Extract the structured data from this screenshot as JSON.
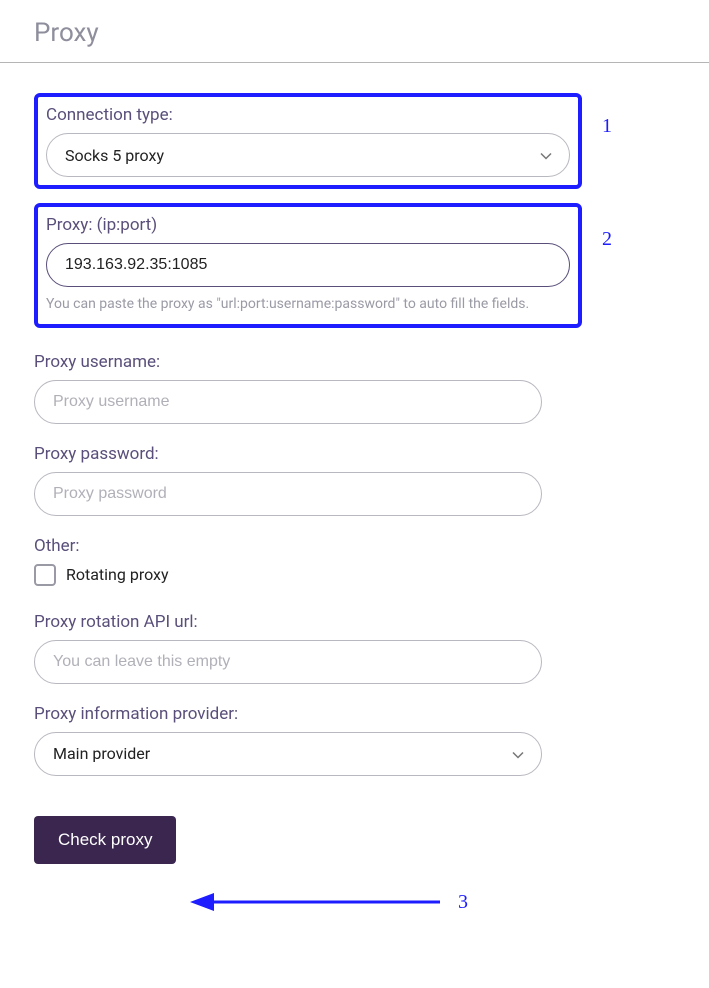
{
  "title": "Proxy",
  "annotations": {
    "one": "1",
    "two": "2",
    "three": "3"
  },
  "connection": {
    "label": "Connection type:",
    "value": "Socks 5 proxy"
  },
  "proxy": {
    "label": "Proxy: (ip:port)",
    "value": "193.163.92.35:1085",
    "hint": "You can paste the proxy as \"url:port:username:password\" to auto fill the fields."
  },
  "username": {
    "label": "Proxy username:",
    "placeholder": "Proxy username"
  },
  "password": {
    "label": "Proxy password:",
    "placeholder": "Proxy password"
  },
  "other": {
    "label": "Other:",
    "checkbox_label": "Rotating proxy"
  },
  "rotation": {
    "label": "Proxy rotation API url:",
    "placeholder": "You can leave this empty"
  },
  "provider": {
    "label": "Proxy information provider:",
    "value": "Main provider"
  },
  "check_button": "Check proxy"
}
